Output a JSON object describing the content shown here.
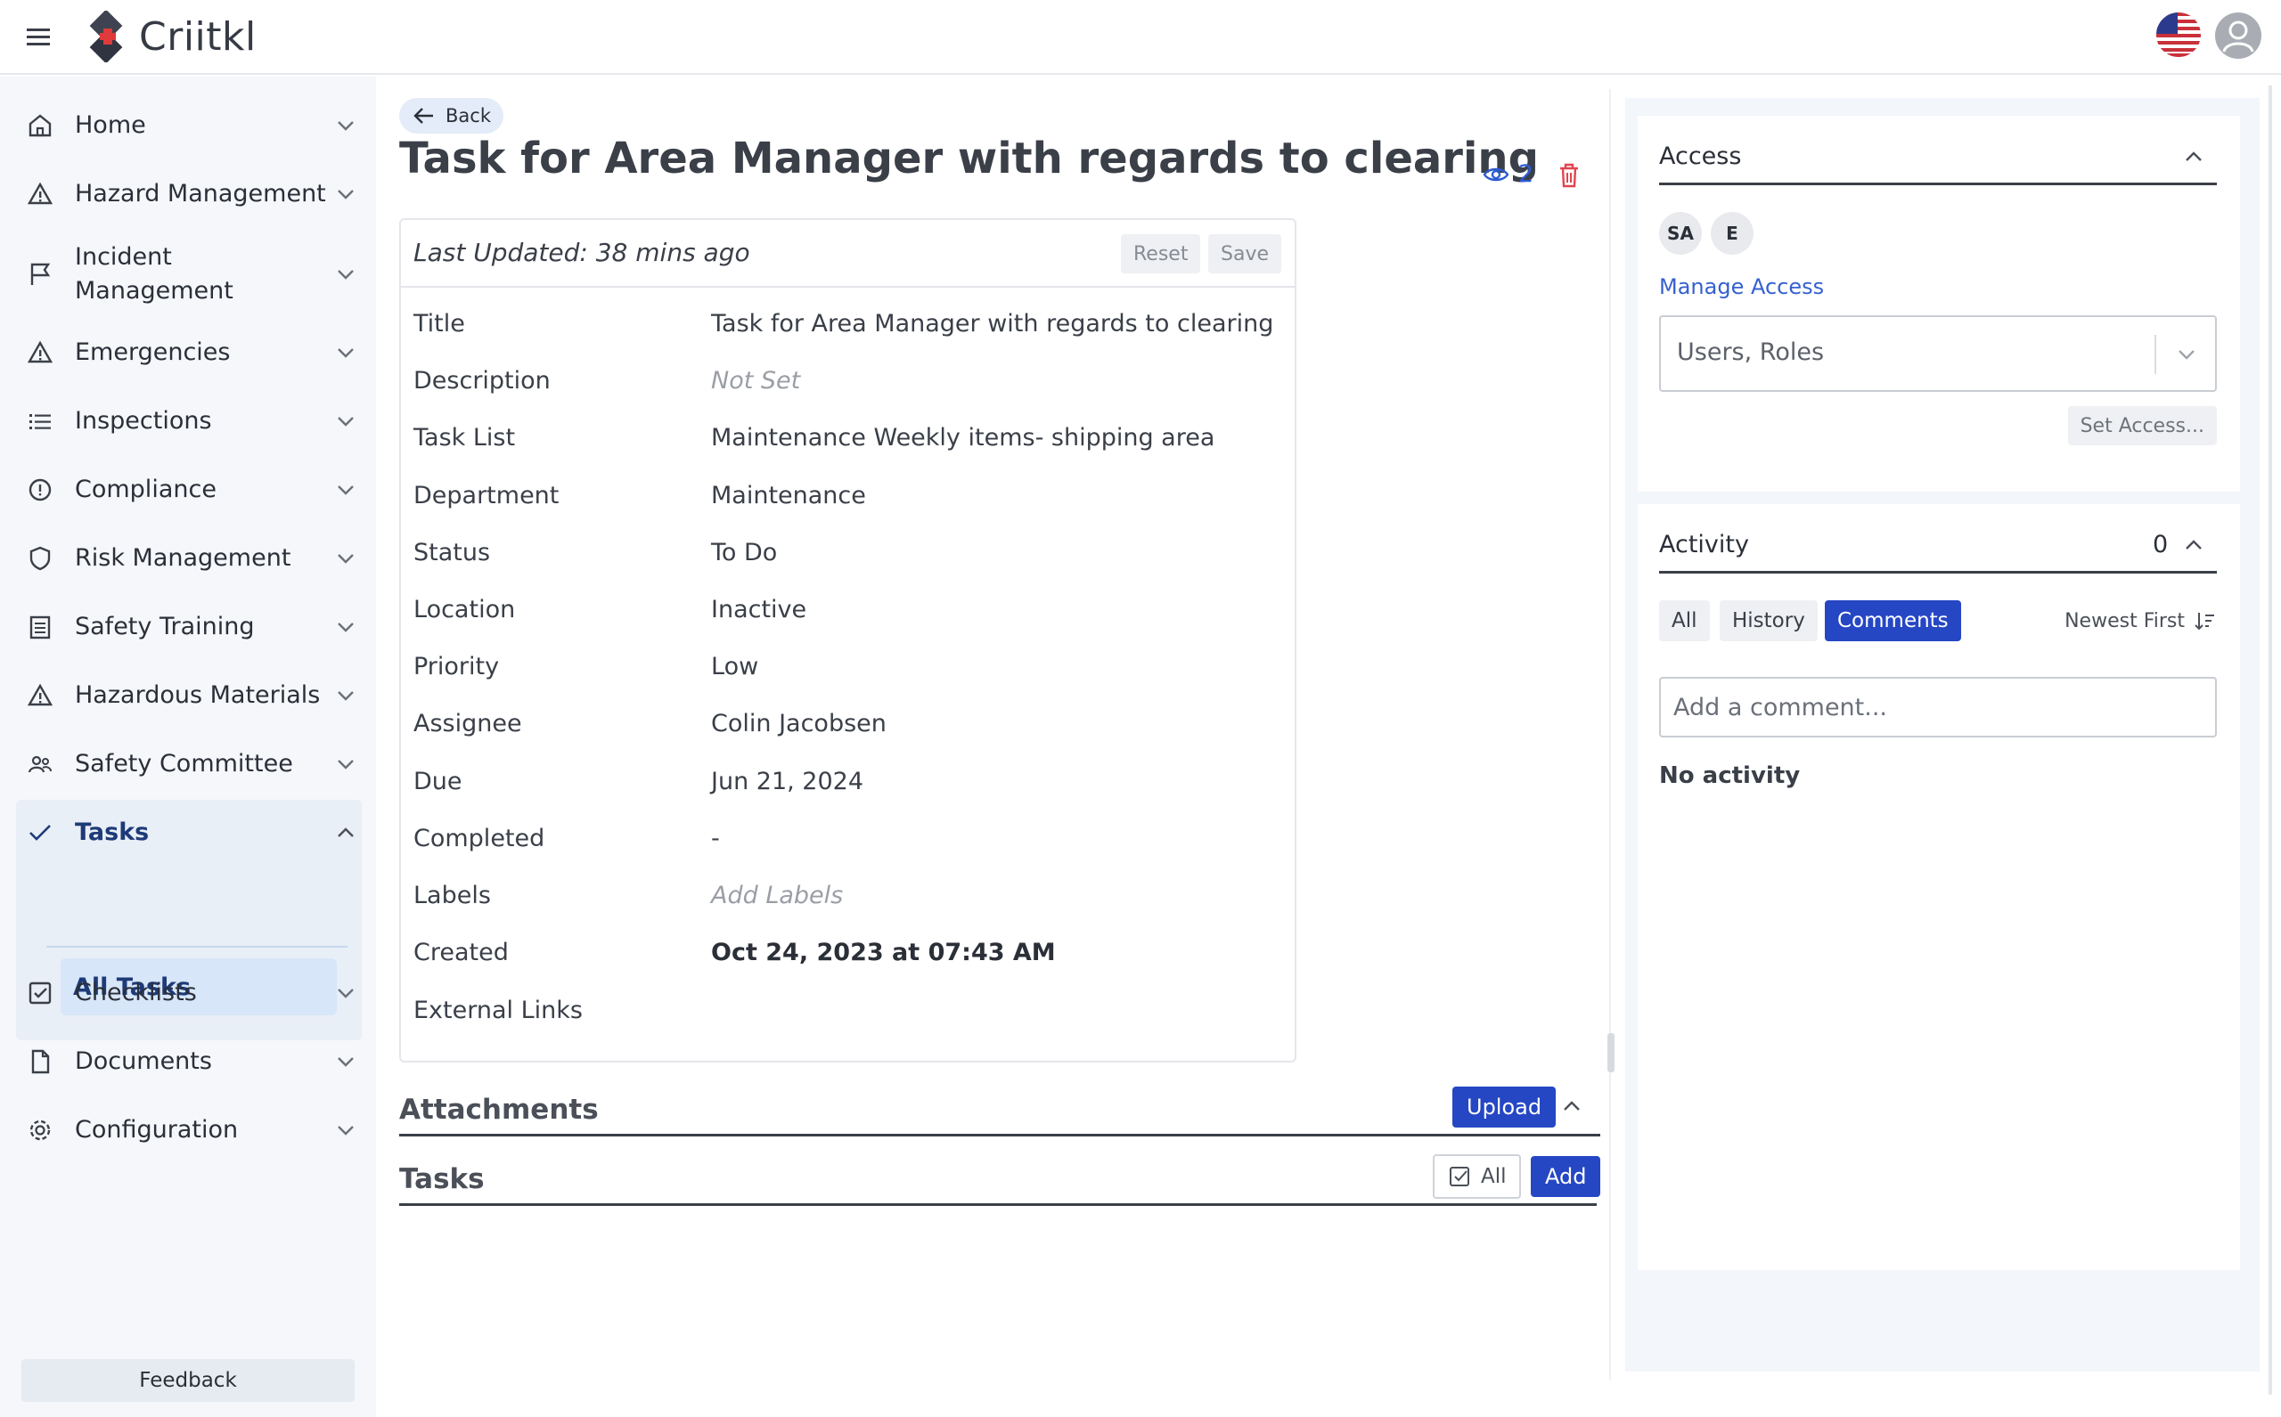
{
  "app": {
    "name": "Criitkl"
  },
  "sidebar": {
    "items": [
      {
        "label": "Home",
        "icon": "home-icon"
      },
      {
        "label": "Hazard Management",
        "icon": "warning-icon"
      },
      {
        "label": "Incident Management",
        "icon": "flag-icon"
      },
      {
        "label": "Emergencies",
        "icon": "warning-icon"
      },
      {
        "label": "Inspections",
        "icon": "list-icon"
      },
      {
        "label": "Compliance",
        "icon": "info-circle-icon"
      },
      {
        "label": "Risk Management",
        "icon": "shield-icon"
      },
      {
        "label": "Safety Training",
        "icon": "document-list-icon"
      },
      {
        "label": "Hazardous Materials",
        "icon": "warning-icon"
      },
      {
        "label": "Safety Committee",
        "icon": "users-icon"
      },
      {
        "label": "Tasks",
        "icon": "check-icon"
      },
      {
        "label": "Checklists",
        "icon": "checkbox-icon"
      },
      {
        "label": "Documents",
        "icon": "file-icon"
      },
      {
        "label": "Configuration",
        "icon": "gear-icon"
      }
    ],
    "sub_item": "All Tasks",
    "feedback": "Feedback"
  },
  "main": {
    "back_label": "Back",
    "title": "Task for Area Manager with regards to clearing",
    "watchers": "2",
    "last_updated": "Last Updated: 38 mins ago",
    "reset_label": "Reset",
    "save_label": "Save",
    "fields": [
      {
        "label": "Title",
        "value": "Task for Area Manager with regards to clearing",
        "style": "normal"
      },
      {
        "label": "Description",
        "value": "Not Set",
        "style": "muted"
      },
      {
        "label": "Task List",
        "value": "Maintenance Weekly items- shipping area",
        "style": "normal"
      },
      {
        "label": "Department",
        "value": "Maintenance",
        "style": "normal"
      },
      {
        "label": "Status",
        "value": "To Do",
        "style": "normal"
      },
      {
        "label": "Location",
        "value": "Inactive",
        "style": "normal"
      },
      {
        "label": "Priority",
        "value": "Low",
        "style": "normal"
      },
      {
        "label": "Assignee",
        "value": "Colin Jacobsen",
        "style": "normal"
      },
      {
        "label": "Due",
        "value": "Jun 21, 2024",
        "style": "normal"
      },
      {
        "label": "Completed",
        "value": "-",
        "style": "normal"
      },
      {
        "label": "Labels",
        "value": "Add Labels",
        "style": "muted"
      },
      {
        "label": "Created",
        "value": "Oct 24, 2023 at 07:43 AM",
        "style": "bold"
      },
      {
        "label": "External Links",
        "value": "",
        "style": "normal"
      }
    ],
    "attachments_title": "Attachments",
    "upload_label": "Upload",
    "tasks_title": "Tasks",
    "all_label": "All",
    "add_label": "Add"
  },
  "access": {
    "title": "Access",
    "chips": [
      "SA",
      "E"
    ],
    "manage_label": "Manage Access",
    "select_placeholder": "Users, Roles",
    "set_access_label": "Set Access..."
  },
  "activity": {
    "title": "Activity",
    "count": "0",
    "tabs": [
      "All",
      "History",
      "Comments"
    ],
    "active_tab": "Comments",
    "sort_label": "Newest First",
    "comment_placeholder": "Add a comment...",
    "empty_text": "No activity"
  },
  "colors": {
    "primary": "#2547c4",
    "link": "#3560d0",
    "danger": "#e0454f",
    "sidebar_bg": "#f5f7fa",
    "active_group_bg": "#e9eff7"
  }
}
